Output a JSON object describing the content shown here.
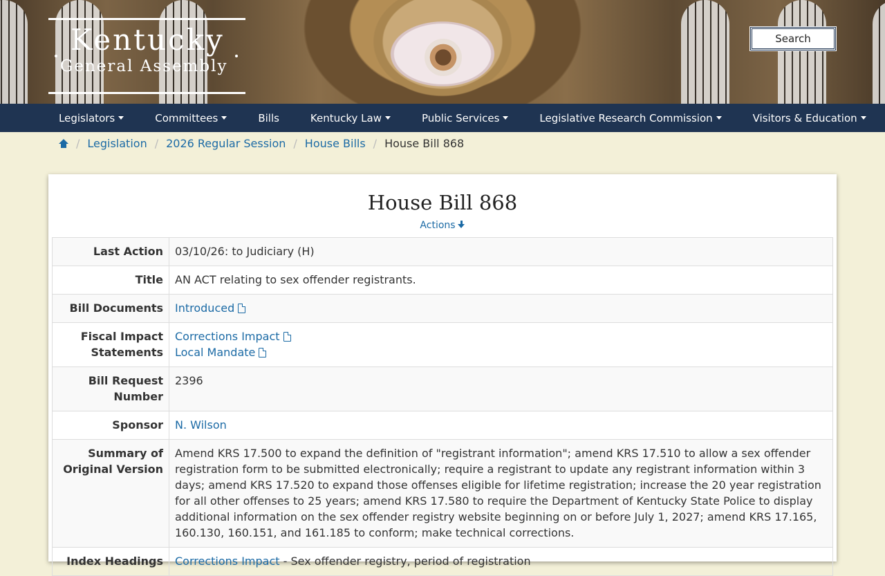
{
  "header": {
    "logo_line1": "Kentucky",
    "logo_line2": "General Assembly",
    "search_label": "Search"
  },
  "nav": {
    "items": [
      {
        "label": "Legislators",
        "dropdown": true
      },
      {
        "label": "Committees",
        "dropdown": true
      },
      {
        "label": "Bills",
        "dropdown": false
      },
      {
        "label": "Kentucky Law",
        "dropdown": true
      },
      {
        "label": "Public Services",
        "dropdown": true
      },
      {
        "label": "Legislative Research Commission",
        "dropdown": true
      },
      {
        "label": "Visitors & Education",
        "dropdown": true
      }
    ]
  },
  "breadcrumb": {
    "home_icon": "home-icon",
    "items": [
      "Legislation",
      "2026 Regular Session",
      "House Bills"
    ],
    "current": "House Bill 868"
  },
  "bill": {
    "title": "House Bill 868",
    "actions_link": "Actions",
    "rows": {
      "last_action": {
        "label": "Last Action",
        "value": "03/10/26: to Judiciary (H)"
      },
      "title": {
        "label": "Title",
        "value": "AN ACT relating to sex offender registrants."
      },
      "documents": {
        "label": "Bill Documents",
        "links": [
          "Introduced"
        ]
      },
      "fiscal": {
        "label": "Fiscal Impact Statements",
        "links": [
          "Corrections Impact",
          "Local Mandate"
        ]
      },
      "request": {
        "label": "Bill Request Number",
        "value": "2396"
      },
      "sponsor": {
        "label": "Sponsor",
        "value": "N. Wilson"
      },
      "summary": {
        "label": "Summary of Original Version",
        "value": "Amend KRS 17.500 to expand the definition of \"registrant information\"; amend KRS 17.510 to allow a sex offender registration form to be submitted electronically; require a registrant to update any registrant information within 3 days; amend KRS 17.520 to expand those offenses eligible for lifetime registration; increase the 20 year registration for all other offenses to 25 years; amend KRS 17.580 to require the Department of Kentucky State Police to display additional information on the sex offender registry website beginning on or before July 1, 2027; amend KRS 17.165, 160.130, 160.151, and 161.185 to conform; make technical corrections."
      },
      "index": {
        "label": "Index Headings",
        "link": "Corrections Impact",
        "value": " - Sex offender registry, period of registration"
      }
    }
  }
}
